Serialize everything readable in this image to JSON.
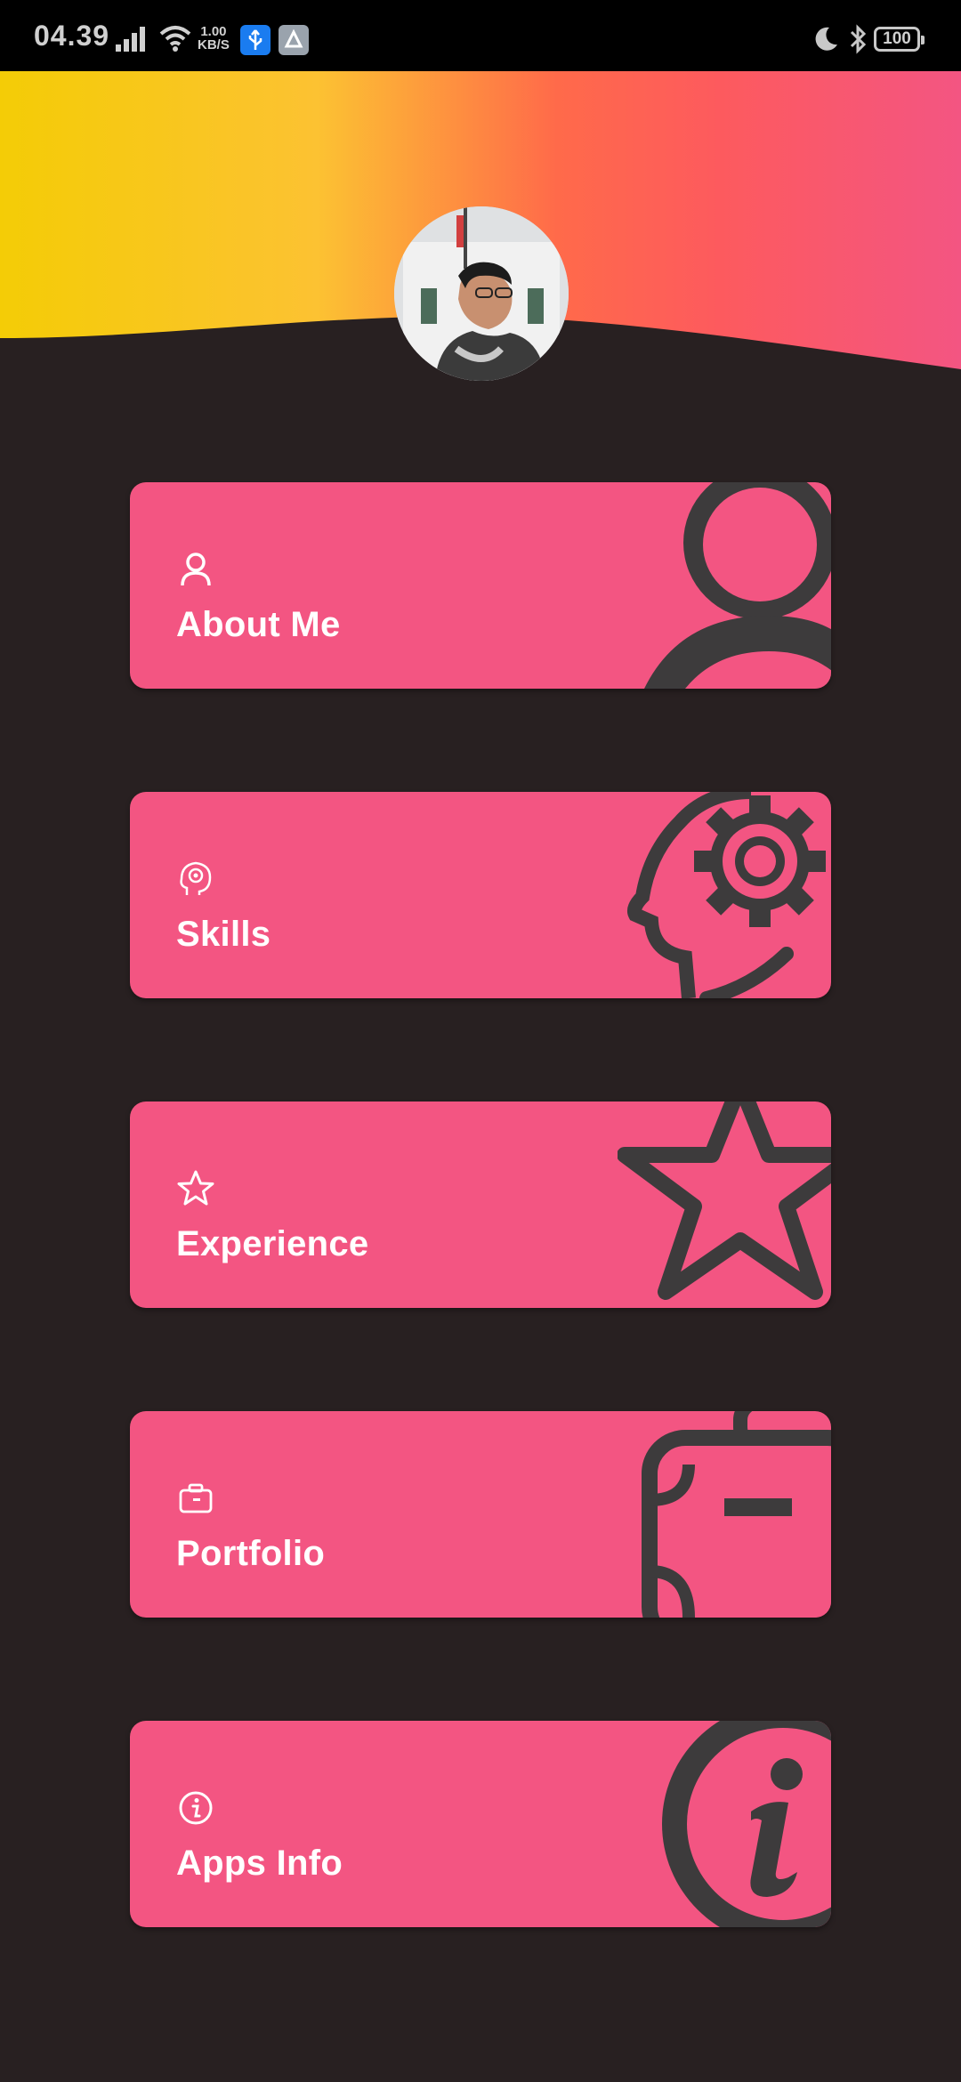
{
  "status_bar": {
    "time": "04.39",
    "net_speed_value": "1.00",
    "net_speed_unit": "KB/S",
    "battery": "100",
    "icons": [
      "signal-icon",
      "wifi-icon",
      "usb-icon",
      "share-icon",
      "moon-icon",
      "bluetooth-icon",
      "battery-icon"
    ]
  },
  "header": {
    "gradient_colors": [
      "#f4cc06",
      "#fcc232",
      "#ff6a4a",
      "#fd5a5e",
      "#f35582"
    ]
  },
  "menu": {
    "items": [
      {
        "label": "About Me",
        "icon": "person-icon"
      },
      {
        "label": "Skills",
        "icon": "head-gear-icon"
      },
      {
        "label": "Experience",
        "icon": "star-icon"
      },
      {
        "label": "Portfolio",
        "icon": "briefcase-icon"
      },
      {
        "label": "Apps Info",
        "icon": "info-icon"
      }
    ]
  },
  "colors": {
    "background": "#282021",
    "card": "#f35582",
    "card_decoration": "#3d3b3c",
    "text": "#ffffff"
  }
}
